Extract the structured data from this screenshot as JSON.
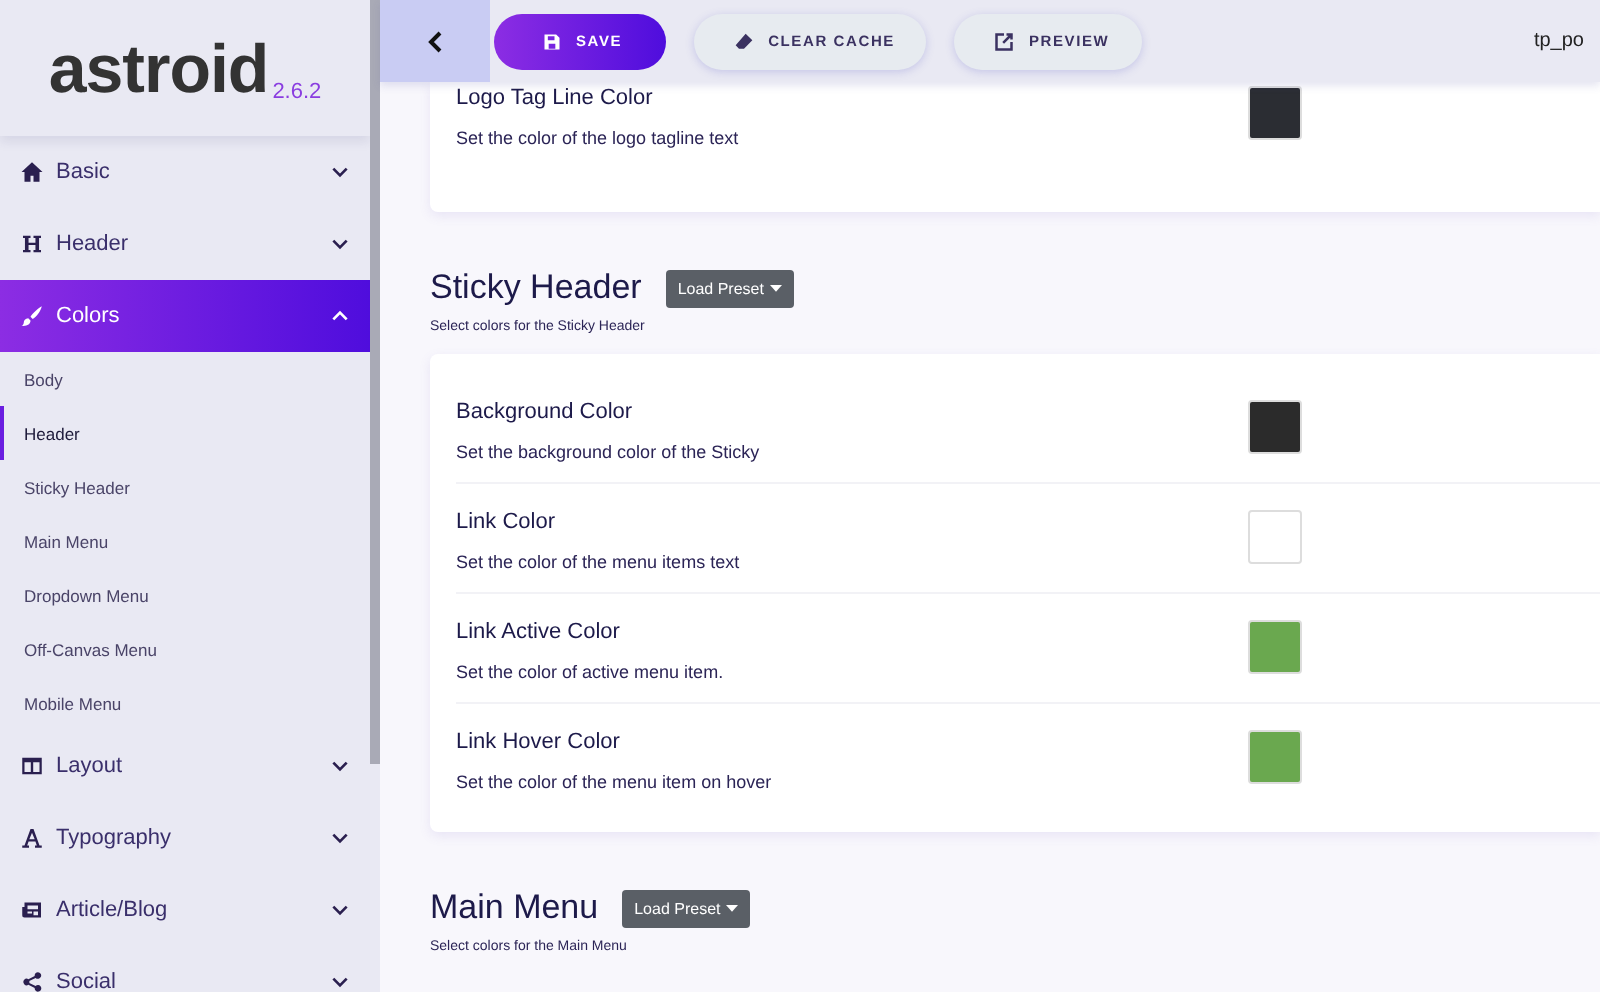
{
  "logo": {
    "name": "astroid",
    "version": "2.6.2"
  },
  "sidebar": {
    "items": [
      {
        "label": "Basic",
        "expanded": false,
        "selected": false
      },
      {
        "label": "Header",
        "expanded": false,
        "selected": false
      },
      {
        "label": "Colors",
        "expanded": true,
        "selected": true,
        "children": [
          {
            "label": "Body",
            "selected": false
          },
          {
            "label": "Header",
            "selected": true
          },
          {
            "label": "Sticky Header",
            "selected": false
          },
          {
            "label": "Main Menu",
            "selected": false
          },
          {
            "label": "Dropdown Menu",
            "selected": false
          },
          {
            "label": "Off-Canvas Menu",
            "selected": false
          },
          {
            "label": "Mobile Menu",
            "selected": false
          }
        ]
      },
      {
        "label": "Layout",
        "expanded": false,
        "selected": false
      },
      {
        "label": "Typography",
        "expanded": false,
        "selected": false
      },
      {
        "label": "Article/Blog",
        "expanded": false,
        "selected": false
      },
      {
        "label": "Social",
        "expanded": false,
        "selected": false
      }
    ]
  },
  "toolbar": {
    "buttons": [
      {
        "kind": "save",
        "label": "SAVE"
      },
      {
        "kind": "clear",
        "label": "CLEAR CACHE"
      },
      {
        "kind": "preview",
        "label": "PREVIEW"
      }
    ],
    "template": "tp_po"
  },
  "sections": [
    {
      "rows": [
        {
          "title": "Logo Tag Line Color",
          "description": "Set the color of the logo tagline text",
          "color": "#2b2d33"
        }
      ]
    },
    {
      "title": "Sticky Header",
      "preset": "Load Preset",
      "subtitle": "Select colors for the Sticky Header",
      "rows": [
        {
          "title": "Background Color",
          "description": "Set the background color of the Sticky",
          "color": "#2b2b2b"
        },
        {
          "title": "Link Color",
          "description": "Set the color of the menu items text",
          "color": "#ffffff"
        },
        {
          "title": "Link Active Color",
          "description": "Set the color of active menu item.",
          "color": "#6aa84f"
        },
        {
          "title": "Link Hover Color",
          "description": "Set the color of the menu item on hover",
          "color": "#6aa84f"
        }
      ]
    },
    {
      "title": "Main Menu",
      "preset": "Load Preset",
      "subtitle": "Select colors for the Main Menu"
    }
  ]
}
